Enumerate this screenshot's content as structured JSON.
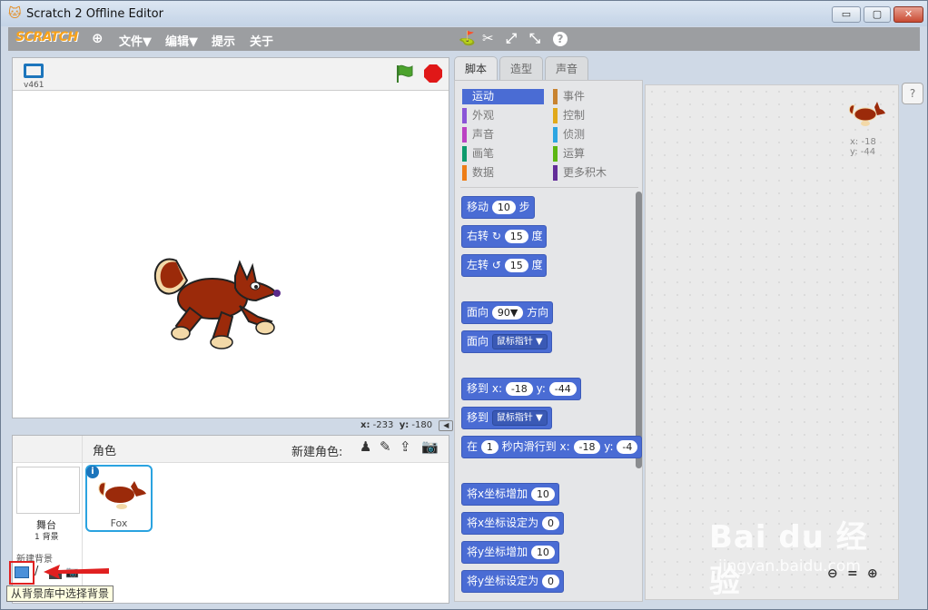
{
  "window": {
    "title": "Scratch 2 Offline Editor",
    "min": "▭",
    "max": "▢",
    "close": "✕"
  },
  "menu": {
    "logo": "SCRATCH",
    "file": "文件▼",
    "edit": "编辑▼",
    "tips": "提示",
    "about": "关于"
  },
  "stage": {
    "version": "v461",
    "x_label": "x:",
    "x_value": "-233",
    "y_label": "y:",
    "y_value": "-180"
  },
  "sprites": {
    "title": "角色",
    "new_sprite": "新建角色:",
    "stage_label": "舞台",
    "stage_count": "1 背景",
    "new_backdrop": "新建背景",
    "sprite_name": "Fox",
    "info": "i",
    "tooltip": "从背景库中选择背景"
  },
  "tabs": {
    "scripts": "脚本",
    "costumes": "造型",
    "sounds": "声音"
  },
  "categories": [
    {
      "label": "运动",
      "color": "#4a6cd4",
      "active": true
    },
    {
      "label": "事件",
      "color": "#c88330"
    },
    {
      "label": "外观",
      "color": "#8a55d7"
    },
    {
      "label": "控制",
      "color": "#e1a91a"
    },
    {
      "label": "声音",
      "color": "#bb42c3"
    },
    {
      "label": "侦测",
      "color": "#2ca5e2"
    },
    {
      "label": "画笔",
      "color": "#0e9a6c"
    },
    {
      "label": "运算",
      "color": "#5cb712"
    },
    {
      "label": "数据",
      "color": "#ee7d16"
    },
    {
      "label": "更多积木",
      "color": "#632d99"
    }
  ],
  "blocks": {
    "move": "移动",
    "move_val": "10",
    "move_unit": "步",
    "turn_r": "右转",
    "turn_r_val": "15",
    "deg": "度",
    "turn_l": "左转",
    "turn_l_val": "15",
    "point": "面向",
    "point_val": "90▼",
    "dir": "方向",
    "point_to": "面向",
    "mouse": "鼠标指针 ▼",
    "goto": "移到",
    "x": "x:",
    "x_val": "-18",
    "y": "y:",
    "y_val": "-44",
    "goto2": "移到",
    "mouse2": "鼠标指针 ▼",
    "glide": "在",
    "glide_val": "1",
    "glide_txt": "秒内滑行到",
    "glide_x": "-18",
    "glide_y": "-4",
    "chx": "将x坐标增加",
    "chx_val": "10",
    "setx": "将x坐标设定为",
    "setx_val": "0",
    "chy": "将y坐标增加",
    "chy_val": "10",
    "sety": "将y坐标设定为",
    "sety_val": "0"
  },
  "script_area": {
    "x_label": "x:",
    "x_value": "-18",
    "y_label": "y:",
    "y_value": "-44",
    "help": "?"
  },
  "watermark": {
    "brand": "Bai du 经验",
    "url": "jingyan.baidu.com"
  }
}
